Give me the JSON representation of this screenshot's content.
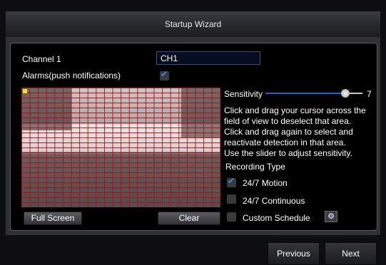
{
  "header": {
    "title": "Startup Wizard"
  },
  "channel": {
    "label": "Channel 1",
    "name_value": "CH1"
  },
  "alarms": {
    "label": "Alarms(push notifications)",
    "checked": true
  },
  "sensitivity": {
    "label": "Sensitivity",
    "value": "7",
    "level": 0.8
  },
  "instructions": [
    "Click and drag your cursor across the",
    "field of view to deselect that area.",
    "Click and drag again to select and",
    "reactivate detection in that area.",
    "Use the slider to adjust sensitivity."
  ],
  "recording": {
    "title": "Recording Type",
    "options": [
      {
        "label": "24/7 Motion",
        "checked": true
      },
      {
        "label": "24/7 Continuous",
        "checked": false
      },
      {
        "label": "Custom Schedule",
        "checked": false
      }
    ]
  },
  "buttons": {
    "full_screen": "Full Screen",
    "clear": "Clear",
    "previous": "Previous",
    "next": "Next"
  },
  "icons": {
    "schedule_settings": "gear-icon",
    "selection_marker": "corner-marker-icon"
  },
  "colors": {
    "accent": "#2f8bff",
    "grid": "#c80000",
    "slider_fill": "#1f60d8"
  }
}
